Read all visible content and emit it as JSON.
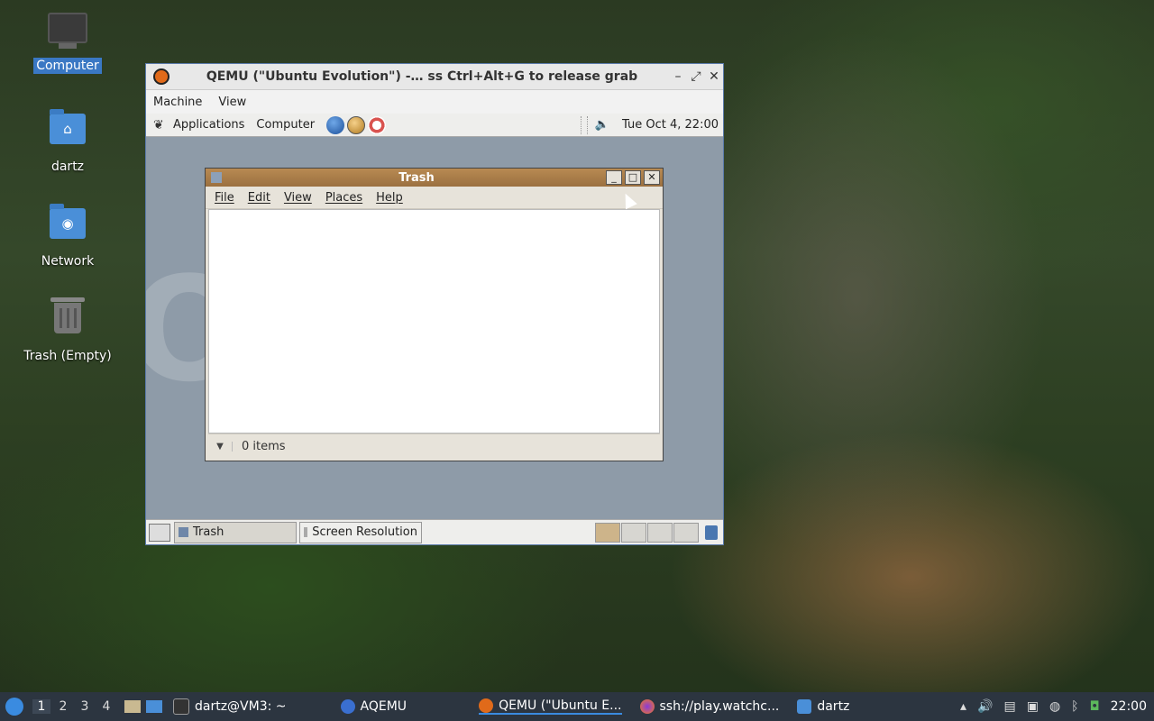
{
  "desktop": {
    "icons": [
      {
        "label": "Computer",
        "selected": true
      },
      {
        "label": "dartz"
      },
      {
        "label": "Network"
      },
      {
        "label": "Trash (Empty)"
      }
    ]
  },
  "qemu": {
    "title": "QEMU (\"Ubuntu Evolution\") -… ss Ctrl+Alt+G to release grab",
    "menu": [
      "Machine",
      "View"
    ],
    "buttons": [
      "–",
      "⤢",
      "✕"
    ]
  },
  "guest_top_panel": {
    "menus": [
      "Applications",
      "Computer"
    ],
    "clock": "Tue Oct  4, 22:00"
  },
  "trash_window": {
    "title": "Trash",
    "menu": [
      "File",
      "Edit",
      "View",
      "Places",
      "Help"
    ],
    "status": "0 items"
  },
  "guest_bottom_panel": {
    "tasks": [
      "Trash",
      "Screen Resolution"
    ]
  },
  "host_taskbar": {
    "workspaces": [
      "1",
      "2",
      "3",
      "4"
    ],
    "tasks": [
      "dartz@VM3: ~",
      "AQEMU",
      "QEMU (\"Ubuntu E...",
      "ssh://play.watchc...",
      "dartz"
    ],
    "clock": "22:00"
  }
}
